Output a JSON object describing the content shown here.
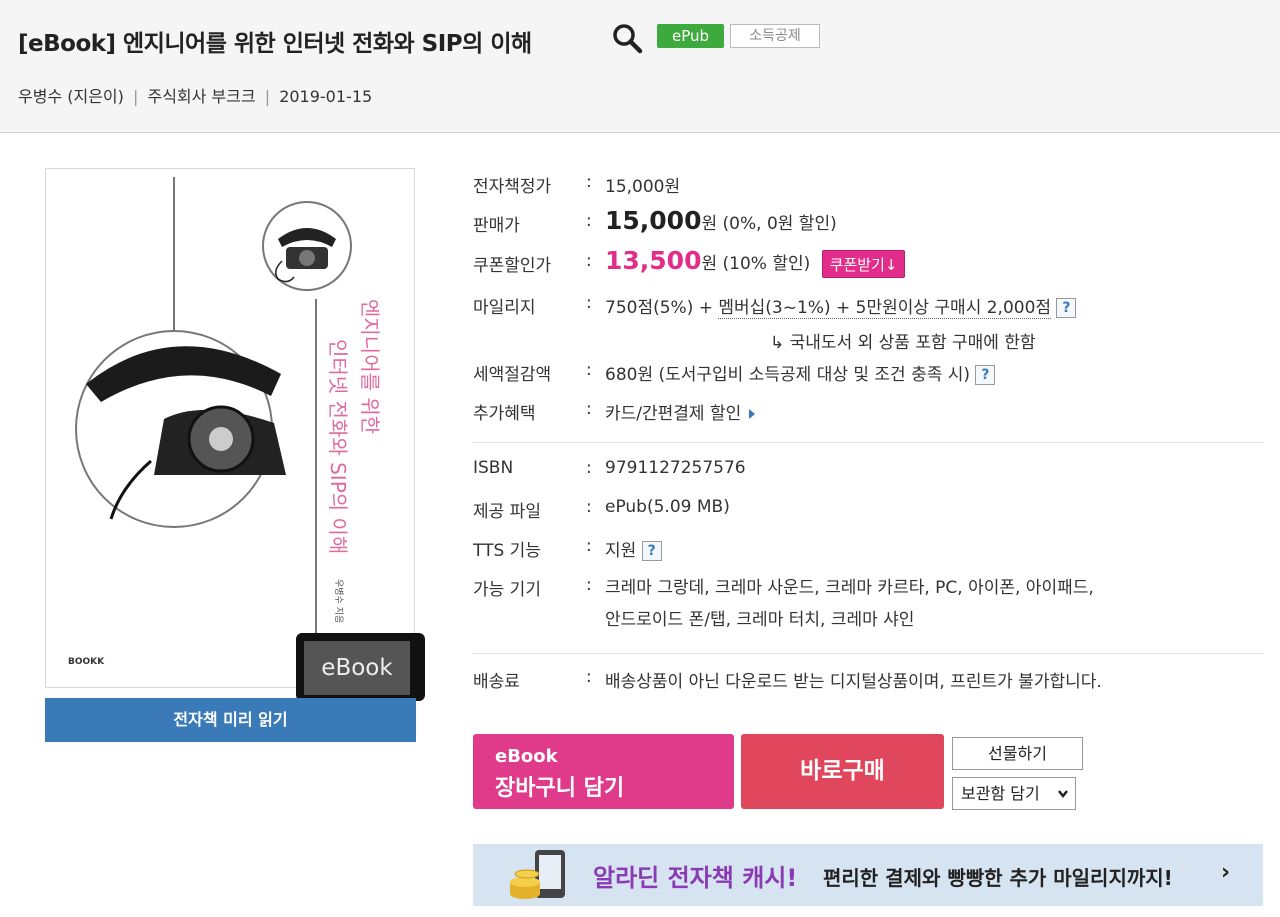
{
  "header": {
    "title": "[eBook] 엔지니어를 위한 인터넷 전화와 SIP의 이해",
    "badge_format": "ePub",
    "badge_tax": "소득공제",
    "author": "우병수 (지은이)",
    "publisher": "주식회사 부크크",
    "date": "2019-01-15",
    "separator": "|"
  },
  "cover": {
    "title_vertical_1": "엔지니어를 위한",
    "title_vertical_2": "인터넷 전화와 SIP의 이해",
    "author_small": "우병수 지음",
    "publisher_logo": "BOOKK",
    "ebook_tag": "eBook",
    "preview_button": "전자책 미리 읽기"
  },
  "colon": ":",
  "price": {
    "list_label": "전자책정가",
    "list_value": "15,000원",
    "sale_label": "판매가",
    "sale_amount": "15,000",
    "sale_unit": "원",
    "sale_note": "(0%, 0원 할인)",
    "coupon_label": "쿠폰할인가",
    "coupon_amount": "13,500",
    "coupon_unit": "원",
    "coupon_note": "(10% 할인)",
    "coupon_button": "쿠폰받기↓"
  },
  "mileage": {
    "label": "마일리지",
    "prefix": "750점(5%) + ",
    "underlined": "멤버십(3~1%) + 5만원이상 구매시 2,000점",
    "help": "?",
    "note": "↳ 국내도서 외 상품 포함 구매에 한함"
  },
  "tax": {
    "label": "세액절감액",
    "value": "680원 (도서구입비 소득공제 대상 및 조건 충족 시)",
    "help": "?"
  },
  "benefit": {
    "label": "추가혜택",
    "value": "카드/간편결제 할인"
  },
  "specs": {
    "isbn_label": "ISBN",
    "isbn_value": "9791127257576",
    "file_label": "제공 파일",
    "file_value": "ePub(5.09 MB)",
    "tts_label": "TTS 기능",
    "tts_value": "지원",
    "tts_help": "?",
    "device_label": "가능 기기",
    "device_line1": "크레마 그랑데, 크레마 사운드, 크레마 카르타, PC, 아이폰, 아이패드,",
    "device_line2": "안드로이드 폰/탭, 크레마 터치, 크레마 샤인"
  },
  "shipping": {
    "label": "배송료",
    "value": "배송상품이 아닌 다운로드 받는 디지털상품이며, 프린트가 불가합니다."
  },
  "actions": {
    "cart_line1": "eBook",
    "cart_line2": "장바구니 담기",
    "buy": "바로구매",
    "gift": "선물하기",
    "box": "보관함 담기"
  },
  "banner": {
    "title": "알라딘 전자책 캐시!",
    "subtitle": "편리한 결제와 빵빵한 추가 마일리지까지!",
    "arrow": "›"
  },
  "colors": {
    "pink": "#e22d8b",
    "blue": "#3a7ab8",
    "green": "#3caa3c",
    "red": "#e0465c"
  }
}
